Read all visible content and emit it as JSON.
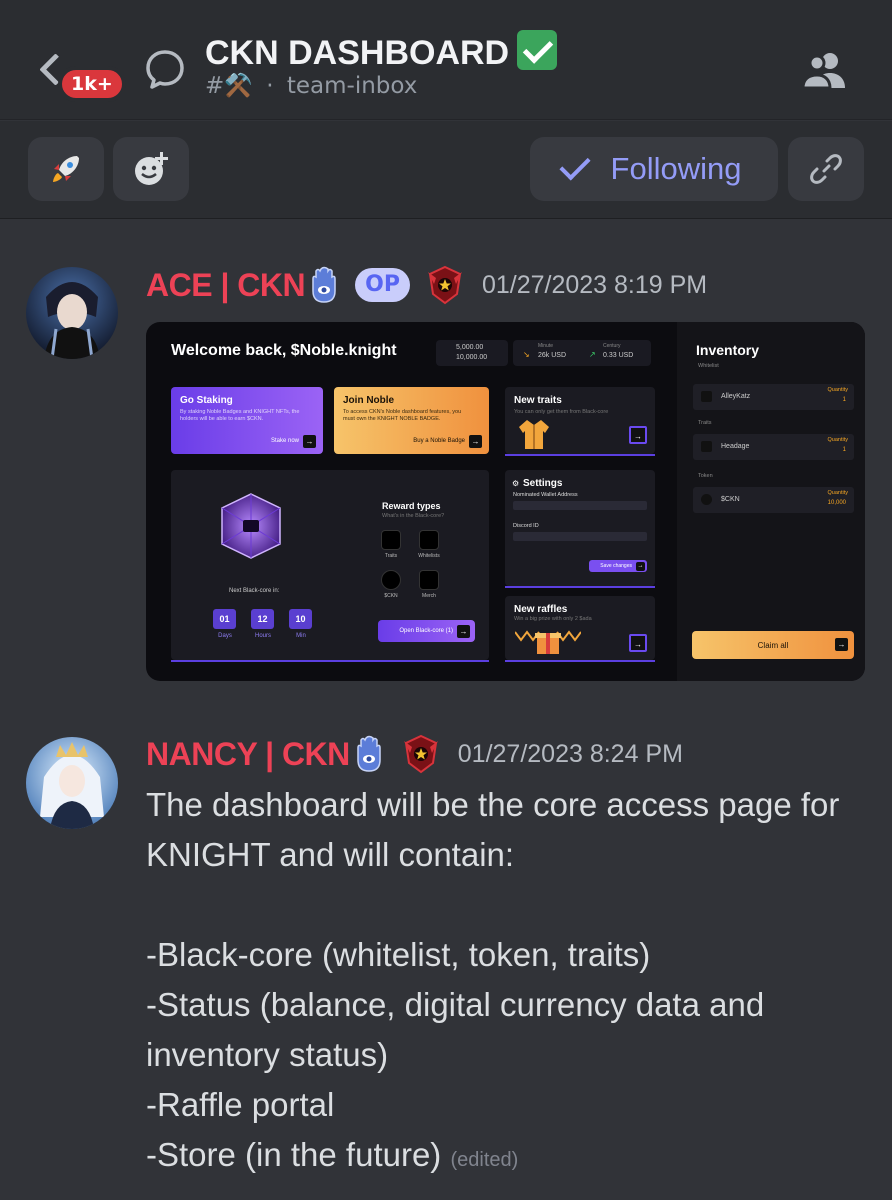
{
  "header": {
    "unread_count": "1k+",
    "title": "CKN DASHBOARD",
    "channel_prefix": "#⚒️",
    "channel_separator": "·",
    "channel_name": "team-inbox"
  },
  "toolbar": {
    "follow_label": "Following"
  },
  "messages": [
    {
      "username": "ACE | CKN",
      "op_badge": "OP",
      "timestamp": "01/27/2023 8:19 PM",
      "attachment": {
        "welcome": "Welcome back, $Noble.knight",
        "stats": {
          "row1": "5,000.00",
          "row2": "10,000.00",
          "minute_label": "Minute",
          "minute_value": "26k USD",
          "century_label": "Century",
          "century_value": "0.33 USD"
        },
        "go_staking": {
          "title": "Go Staking",
          "desc": "By staking Noble Badges and KNIGHT NFTs, the holders will be able to earn $CKN.",
          "button": "Stake now"
        },
        "join_noble": {
          "title": "Join Noble",
          "desc": "To access CKN's Noble dashboard features, you must own the KNIGHT NOBLE BADGE.",
          "button": "Buy a Noble Badge"
        },
        "new_traits": {
          "title": "New traits",
          "desc": "You can only get them from Black-core"
        },
        "settings": {
          "title": "Settings",
          "wallet_label": "Nominated Wallet Address",
          "discord_label": "Discord ID",
          "button": "Save changes"
        },
        "new_raffles": {
          "title": "New raffles",
          "desc": "Win a big prize with only 2 $ada"
        },
        "blackcore": {
          "next_label": "Next Black-core in:",
          "days": "01",
          "days_label": "Days",
          "hours": "12",
          "hours_label": "Hours",
          "min": "10",
          "min_label": "Min",
          "reward_title": "Reward types",
          "reward_sub": "What's in the Black-core?",
          "rewards": [
            "Traits",
            "Whitelists",
            "$CKN",
            "Merch"
          ],
          "open_button": "Open Black-core (1)"
        },
        "inventory": {
          "title": "Inventory",
          "whitelist_label": "Whitelist",
          "traits_label": "Traits",
          "token_label": "Token",
          "quantity_label": "Quantity",
          "items": [
            {
              "name": "AlleyKatz",
              "qty": "1"
            },
            {
              "name": "Headage",
              "qty": "1"
            },
            {
              "name": "$CKN",
              "qty": "10,000"
            }
          ],
          "claim_button": "Claim all"
        }
      }
    },
    {
      "username": "NANCY | CKN",
      "timestamp": "01/27/2023 8:24 PM",
      "lines": [
        "The dashboard will be the core access page for KNIGHT and will contain:",
        "-Black-core (whitelist, token, traits)",
        "-Status (balance, digital currency data and inventory status)",
        "-Raffle portal",
        "-Store (in the future)"
      ],
      "edited": "(edited)"
    }
  ],
  "colors": {
    "background": "#313338",
    "header_bg": "#2b2d31",
    "username_red": "#ed4256",
    "blurple": "#949cf7"
  }
}
